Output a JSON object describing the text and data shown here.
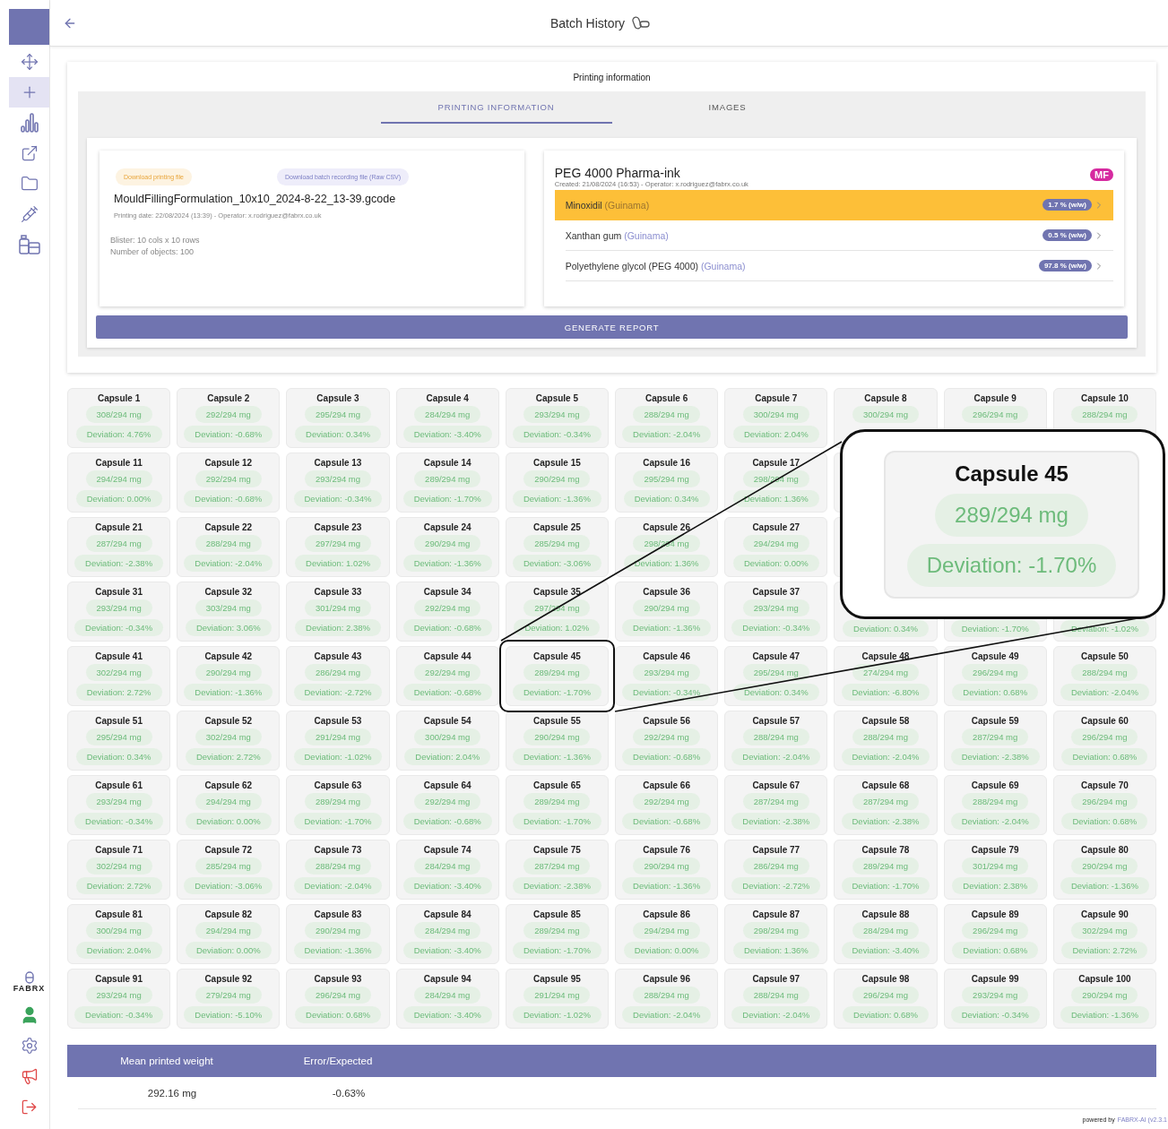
{
  "sidebar": {
    "nav_items": [
      {
        "selected": false
      },
      {
        "selected": true
      },
      {
        "selected": false
      },
      {
        "selected": false
      },
      {
        "selected": false
      },
      {
        "selected": false
      },
      {
        "selected": false
      }
    ],
    "brand": "FABRX"
  },
  "header": {
    "title": "Batch History"
  },
  "printing_panel": {
    "title": "Printing information",
    "tabs": [
      {
        "label": "PRINTING INFORMATION",
        "selected": true
      },
      {
        "label": "IMAGES",
        "selected": false
      }
    ],
    "file_card": {
      "download_buttons": [
        "Download printing file",
        "Download batch recording file (Raw CSV)"
      ],
      "filename": "MouldFillingFormulation_10x10_2024-8-22_13-39.gcode",
      "meta": "Printing date: 22/08/2024 (13:39) - Operator: x.rodriguez@fabrx.co.uk",
      "details": [
        "Blister: 10 cols x 10 rows",
        "Number of objects: 100"
      ]
    },
    "ink_card": {
      "name": "PEG 4000 Pharma-ink",
      "meta": "Created: 21/08/2024 (16:53) - Operator: x.rodriguez@fabrx.co.uk",
      "badge": "MF",
      "ingredients": [
        {
          "name": "Minoxidil",
          "supplier": "(Guinama)",
          "amount": "1.7 % (w/w)",
          "selected": true
        },
        {
          "name": "Xanthan gum",
          "supplier": "(Guinama)",
          "amount": "0.5 % (w/w)",
          "selected": false
        },
        {
          "name": "Polyethylene glycol (PEG 4000)",
          "supplier": "(Guinama)",
          "amount": "97.8 % (w/w)",
          "selected": false
        }
      ]
    },
    "report_button": "GENERATE REPORT"
  },
  "capsule_rows": [
    {
      "capsules": [
        {
          "name": "Capsule 1",
          "weight": "308/294 mg",
          "deviation": "Deviation: 4.76%",
          "highlighted": false
        },
        {
          "name": "Capsule 2",
          "weight": "292/294 mg",
          "deviation": "Deviation: -0.68%",
          "highlighted": false
        },
        {
          "name": "Capsule 3",
          "weight": "295/294 mg",
          "deviation": "Deviation: 0.34%",
          "highlighted": false
        },
        {
          "name": "Capsule 4",
          "weight": "284/294 mg",
          "deviation": "Deviation: -3.40%",
          "highlighted": false
        },
        {
          "name": "Capsule 5",
          "weight": "293/294 mg",
          "deviation": "Deviation: -0.34%",
          "highlighted": false
        },
        {
          "name": "Capsule 6",
          "weight": "288/294 mg",
          "deviation": "Deviation: -2.04%",
          "highlighted": false
        },
        {
          "name": "Capsule 7",
          "weight": "300/294 mg",
          "deviation": "Deviation: 2.04%",
          "highlighted": false
        },
        {
          "name": "Capsule 8",
          "weight": "300/294 mg",
          "highlighted": false
        },
        {
          "name": "Capsule 9",
          "weight": "296/294 mg",
          "highlighted": false
        },
        {
          "name": "Capsule 10",
          "weight": "288/294 mg",
          "highlighted": false
        }
      ]
    },
    {
      "capsules": [
        {
          "name": "Capsule 11",
          "weight": "294/294 mg",
          "deviation": "Deviation: 0.00%",
          "highlighted": false
        },
        {
          "name": "Capsule 12",
          "weight": "292/294 mg",
          "deviation": "Deviation: -0.68%",
          "highlighted": false
        },
        {
          "name": "Capsule 13",
          "weight": "293/294 mg",
          "deviation": "Deviation: -0.34%",
          "highlighted": false
        },
        {
          "name": "Capsule 14",
          "weight": "289/294 mg",
          "deviation": "Deviation: -1.70%",
          "highlighted": false
        },
        {
          "name": "Capsule 15",
          "weight": "290/294 mg",
          "deviation": "Deviation: -1.36%",
          "highlighted": false
        },
        {
          "name": "Capsule 16",
          "weight": "295/294 mg",
          "deviation": "Deviation: 0.34%",
          "highlighted": false
        },
        {
          "name": "Capsule 17",
          "weight": "298/294 mg",
          "deviation": "Deviation: 1.36%",
          "highlighted": false
        }
      ]
    },
    {
      "capsules": [
        {
          "name": "Capsule 21",
          "weight": "287/294 mg",
          "deviation": "Deviation: -2.38%",
          "highlighted": false
        },
        {
          "name": "Capsule 22",
          "weight": "288/294 mg",
          "deviation": "Deviation: -2.04%",
          "highlighted": false
        },
        {
          "name": "Capsule 23",
          "weight": "297/294 mg",
          "deviation": "Deviation: 1.02%",
          "highlighted": false
        },
        {
          "name": "Capsule 24",
          "weight": "290/294 mg",
          "deviation": "Deviation: -1.36%",
          "highlighted": false
        },
        {
          "name": "Capsule 25",
          "weight": "285/294 mg",
          "deviation": "Deviation: -3.06%",
          "highlighted": false
        },
        {
          "name": "Capsule 26",
          "weight": "298/294 mg",
          "deviation": "Deviation: 1.36%",
          "highlighted": false
        },
        {
          "name": "Capsule 27",
          "weight": "294/294 mg",
          "deviation": "Deviation: 0.00%",
          "highlighted": false
        }
      ]
    },
    {
      "capsules": [
        {
          "name": "Capsule 31",
          "weight": "293/294 mg",
          "deviation": "Deviation: -0.34%",
          "highlighted": false
        },
        {
          "name": "Capsule 32",
          "weight": "303/294 mg",
          "deviation": "Deviation: 3.06%",
          "highlighted": false
        },
        {
          "name": "Capsule 33",
          "weight": "301/294 mg",
          "deviation": "Deviation: 2.38%",
          "highlighted": false
        },
        {
          "name": "Capsule 34",
          "weight": "292/294 mg",
          "deviation": "Deviation: -0.68%",
          "highlighted": false
        },
        {
          "name": "Capsule 35",
          "weight": "297/294 mg",
          "deviation": "Deviation: 1.02%",
          "highlighted": false
        },
        {
          "name": "Capsule 36",
          "weight": "290/294 mg",
          "deviation": "Deviation: -1.36%",
          "highlighted": false
        },
        {
          "name": "Capsule 37",
          "weight": "293/294 mg",
          "deviation": "Deviation: -0.34%",
          "highlighted": false
        },
        {
          "deviation": "Deviation: 0.34%",
          "highlighted": false
        },
        {
          "deviation": "Deviation: -1.70%",
          "highlighted": false
        },
        {
          "deviation": "Deviation: -1.02%",
          "highlighted": false
        }
      ]
    },
    {
      "capsules": [
        {
          "name": "Capsule 41",
          "weight": "302/294 mg",
          "deviation": "Deviation: 2.72%",
          "highlighted": false
        },
        {
          "name": "Capsule 42",
          "weight": "290/294 mg",
          "deviation": "Deviation: -1.36%",
          "highlighted": false
        },
        {
          "name": "Capsule 43",
          "weight": "286/294 mg",
          "deviation": "Deviation: -2.72%",
          "highlighted": false
        },
        {
          "name": "Capsule 44",
          "weight": "292/294 mg",
          "deviation": "Deviation: -0.68%",
          "highlighted": false
        },
        {
          "name": "Capsule 45",
          "weight": "289/294 mg",
          "deviation": "Deviation: -1.70%",
          "highlighted": true
        },
        {
          "name": "Capsule 46",
          "weight": "293/294 mg",
          "deviation": "Deviation: -0.34%",
          "highlighted": false
        },
        {
          "name": "Capsule 47",
          "weight": "295/294 mg",
          "deviation": "Deviation: 0.34%",
          "highlighted": false
        },
        {
          "name": "Capsule 48",
          "weight": "274/294 mg",
          "deviation": "Deviation: -6.80%",
          "highlighted": false
        },
        {
          "name": "Capsule 49",
          "weight": "296/294 mg",
          "deviation": "Deviation: 0.68%",
          "highlighted": false
        },
        {
          "name": "Capsule 50",
          "weight": "288/294 mg",
          "deviation": "Deviation: -2.04%",
          "highlighted": false
        }
      ]
    },
    {
      "capsules": [
        {
          "name": "Capsule 51",
          "weight": "295/294 mg",
          "deviation": "Deviation: 0.34%",
          "highlighted": false
        },
        {
          "name": "Capsule 52",
          "weight": "302/294 mg",
          "deviation": "Deviation: 2.72%",
          "highlighted": false
        },
        {
          "name": "Capsule 53",
          "weight": "291/294 mg",
          "deviation": "Deviation: -1.02%",
          "highlighted": false
        },
        {
          "name": "Capsule 54",
          "weight": "300/294 mg",
          "deviation": "Deviation: 2.04%",
          "highlighted": false
        },
        {
          "name": "Capsule 55",
          "weight": "290/294 mg",
          "deviation": "Deviation: -1.36%",
          "highlighted": false
        },
        {
          "name": "Capsule 56",
          "weight": "292/294 mg",
          "deviation": "Deviation: -0.68%",
          "highlighted": false
        },
        {
          "name": "Capsule 57",
          "weight": "288/294 mg",
          "deviation": "Deviation: -2.04%",
          "highlighted": false
        },
        {
          "name": "Capsule 58",
          "weight": "288/294 mg",
          "deviation": "Deviation: -2.04%",
          "highlighted": false
        },
        {
          "name": "Capsule 59",
          "weight": "287/294 mg",
          "deviation": "Deviation: -2.38%",
          "highlighted": false
        },
        {
          "name": "Capsule 60",
          "weight": "296/294 mg",
          "deviation": "Deviation: 0.68%",
          "highlighted": false
        }
      ]
    },
    {
      "capsules": [
        {
          "name": "Capsule 61",
          "weight": "293/294 mg",
          "deviation": "Deviation: -0.34%",
          "highlighted": false
        },
        {
          "name": "Capsule 62",
          "weight": "294/294 mg",
          "deviation": "Deviation: 0.00%",
          "highlighted": false
        },
        {
          "name": "Capsule 63",
          "weight": "289/294 mg",
          "deviation": "Deviation: -1.70%",
          "highlighted": false
        },
        {
          "name": "Capsule 64",
          "weight": "292/294 mg",
          "deviation": "Deviation: -0.68%",
          "highlighted": false
        },
        {
          "name": "Capsule 65",
          "weight": "289/294 mg",
          "deviation": "Deviation: -1.70%",
          "highlighted": false
        },
        {
          "name": "Capsule 66",
          "weight": "292/294 mg",
          "deviation": "Deviation: -0.68%",
          "highlighted": false
        },
        {
          "name": "Capsule 67",
          "weight": "287/294 mg",
          "deviation": "Deviation: -2.38%",
          "highlighted": false
        },
        {
          "name": "Capsule 68",
          "weight": "287/294 mg",
          "deviation": "Deviation: -2.38%",
          "highlighted": false
        },
        {
          "name": "Capsule 69",
          "weight": "288/294 mg",
          "deviation": "Deviation: -2.04%",
          "highlighted": false
        },
        {
          "name": "Capsule 70",
          "weight": "296/294 mg",
          "deviation": "Deviation: 0.68%",
          "highlighted": false
        }
      ]
    },
    {
      "capsules": [
        {
          "name": "Capsule 71",
          "weight": "302/294 mg",
          "deviation": "Deviation: 2.72%",
          "highlighted": false
        },
        {
          "name": "Capsule 72",
          "weight": "285/294 mg",
          "deviation": "Deviation: -3.06%",
          "highlighted": false
        },
        {
          "name": "Capsule 73",
          "weight": "288/294 mg",
          "deviation": "Deviation: -2.04%",
          "highlighted": false
        },
        {
          "name": "Capsule 74",
          "weight": "284/294 mg",
          "deviation": "Deviation: -3.40%",
          "highlighted": false
        },
        {
          "name": "Capsule 75",
          "weight": "287/294 mg",
          "deviation": "Deviation: -2.38%",
          "highlighted": false
        },
        {
          "name": "Capsule 76",
          "weight": "290/294 mg",
          "deviation": "Deviation: -1.36%",
          "highlighted": false
        },
        {
          "name": "Capsule 77",
          "weight": "286/294 mg",
          "deviation": "Deviation: -2.72%",
          "highlighted": false
        },
        {
          "name": "Capsule 78",
          "weight": "289/294 mg",
          "deviation": "Deviation: -1.70%",
          "highlighted": false
        },
        {
          "name": "Capsule 79",
          "weight": "301/294 mg",
          "deviation": "Deviation: 2.38%",
          "highlighted": false
        },
        {
          "name": "Capsule 80",
          "weight": "290/294 mg",
          "deviation": "Deviation: -1.36%",
          "highlighted": false
        }
      ]
    },
    {
      "capsules": [
        {
          "name": "Capsule 81",
          "weight": "300/294 mg",
          "deviation": "Deviation: 2.04%",
          "highlighted": false
        },
        {
          "name": "Capsule 82",
          "weight": "294/294 mg",
          "deviation": "Deviation: 0.00%",
          "highlighted": false
        },
        {
          "name": "Capsule 83",
          "weight": "290/294 mg",
          "deviation": "Deviation: -1.36%",
          "highlighted": false
        },
        {
          "name": "Capsule 84",
          "weight": "284/294 mg",
          "deviation": "Deviation: -3.40%",
          "highlighted": false
        },
        {
          "name": "Capsule 85",
          "weight": "289/294 mg",
          "deviation": "Deviation: -1.70%",
          "highlighted": false
        },
        {
          "name": "Capsule 86",
          "weight": "294/294 mg",
          "deviation": "Deviation: 0.00%",
          "highlighted": false
        },
        {
          "name": "Capsule 87",
          "weight": "298/294 mg",
          "deviation": "Deviation: 1.36%",
          "highlighted": false
        },
        {
          "name": "Capsule 88",
          "weight": "284/294 mg",
          "deviation": "Deviation: -3.40%",
          "highlighted": false
        },
        {
          "name": "Capsule 89",
          "weight": "296/294 mg",
          "deviation": "Deviation: 0.68%",
          "highlighted": false
        },
        {
          "name": "Capsule 90",
          "weight": "302/294 mg",
          "deviation": "Deviation: 2.72%",
          "highlighted": false
        }
      ]
    },
    {
      "capsules": [
        {
          "name": "Capsule 91",
          "weight": "293/294 mg",
          "deviation": "Deviation: -0.34%",
          "highlighted": false
        },
        {
          "name": "Capsule 92",
          "weight": "279/294 mg",
          "deviation": "Deviation: -5.10%",
          "highlighted": false
        },
        {
          "name": "Capsule 93",
          "weight": "296/294 mg",
          "deviation": "Deviation: 0.68%",
          "highlighted": false
        },
        {
          "name": "Capsule 94",
          "weight": "284/294 mg",
          "deviation": "Deviation: -3.40%",
          "highlighted": false
        },
        {
          "name": "Capsule 95",
          "weight": "291/294 mg",
          "deviation": "Deviation: -1.02%",
          "highlighted": false
        },
        {
          "name": "Capsule 96",
          "weight": "288/294 mg",
          "deviation": "Deviation: -2.04%",
          "highlighted": false
        },
        {
          "name": "Capsule 97",
          "weight": "288/294 mg",
          "deviation": "Deviation: -2.04%",
          "highlighted": false
        },
        {
          "name": "Capsule 98",
          "weight": "296/294 mg",
          "deviation": "Deviation: 0.68%",
          "highlighted": false
        },
        {
          "name": "Capsule 99",
          "weight": "293/294 mg",
          "deviation": "Deviation: -0.34%",
          "highlighted": false
        },
        {
          "name": "Capsule 100",
          "weight": "290/294 mg",
          "deviation": "Deviation: -1.36%",
          "highlighted": false
        }
      ]
    }
  ],
  "zoom_callout": {
    "name": "Capsule 45",
    "weight": "289/294 mg",
    "deviation": "Deviation: -1.70%"
  },
  "summary_table": {
    "columns": [
      "Mean printed weight",
      "Error/Expected"
    ],
    "row": [
      "292.16 mg",
      "-0.63%"
    ]
  },
  "footer": {
    "text": "powered by",
    "link": "FABRX-AI (v2.3.1"
  }
}
